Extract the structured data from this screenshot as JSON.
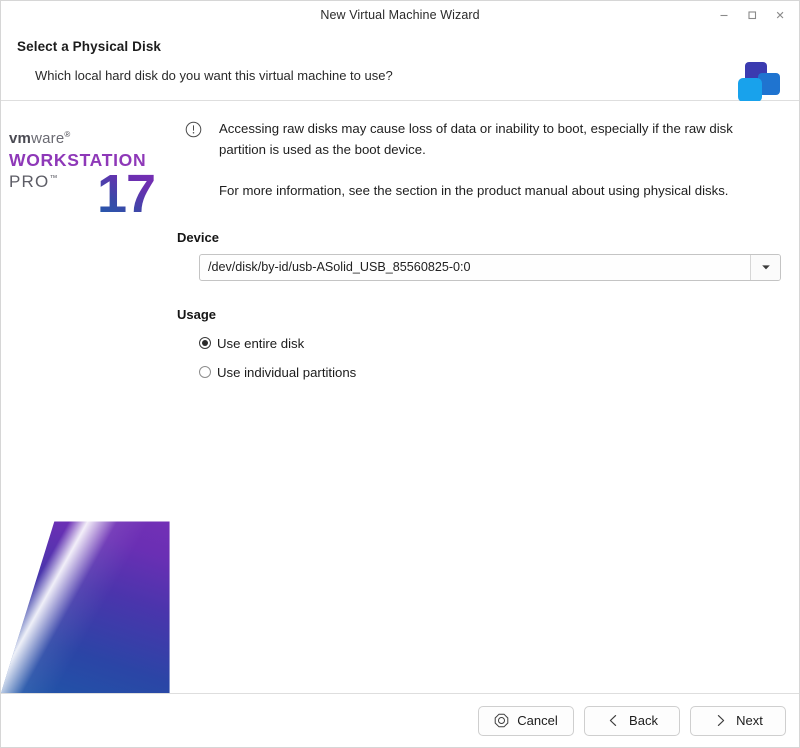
{
  "window": {
    "title": "New Virtual Machine Wizard",
    "controls": {
      "minimize": "minimize-icon",
      "maximize": "maximize-icon",
      "close": "close-icon"
    }
  },
  "header": {
    "title": "Select a Physical Disk",
    "subtitle": "Which local hard disk do you want this virtual machine to use?",
    "logo": "vmware-blocks-logo",
    "logo_colors": [
      "#3b3bb0",
      "#1f74d0",
      "#18a2ec"
    ]
  },
  "branding": {
    "vm": "vm",
    "ware": "ware",
    "registered": "®",
    "product": "WORKSTATION",
    "edition": "PRO",
    "trademark": "™",
    "version": "17",
    "accent_purple": "#8e38b8",
    "accent_blue": "#1f5fae"
  },
  "notice": {
    "icon": "info-circle-icon",
    "paragraphs": [
      "Accessing raw disks may cause loss of data or inability to boot, especially if the raw disk partition is used as the boot device.",
      "For more information, see the section in the product manual about using physical disks."
    ]
  },
  "device": {
    "label": "Device",
    "value": "/dev/disk/by-id/usb-ASolid_USB_85560825-0:0",
    "dropdown_icon": "chevron-down-icon"
  },
  "usage": {
    "label": "Usage",
    "options": [
      {
        "label": "Use entire disk",
        "selected": true
      },
      {
        "label": "Use individual partitions",
        "selected": false
      }
    ]
  },
  "footer": {
    "buttons": [
      {
        "label": "Cancel",
        "icon": "stop-octagon-icon"
      },
      {
        "label": "Back",
        "icon": "chevron-left-icon"
      },
      {
        "label": "Next",
        "icon": "chevron-right-icon"
      }
    ]
  }
}
